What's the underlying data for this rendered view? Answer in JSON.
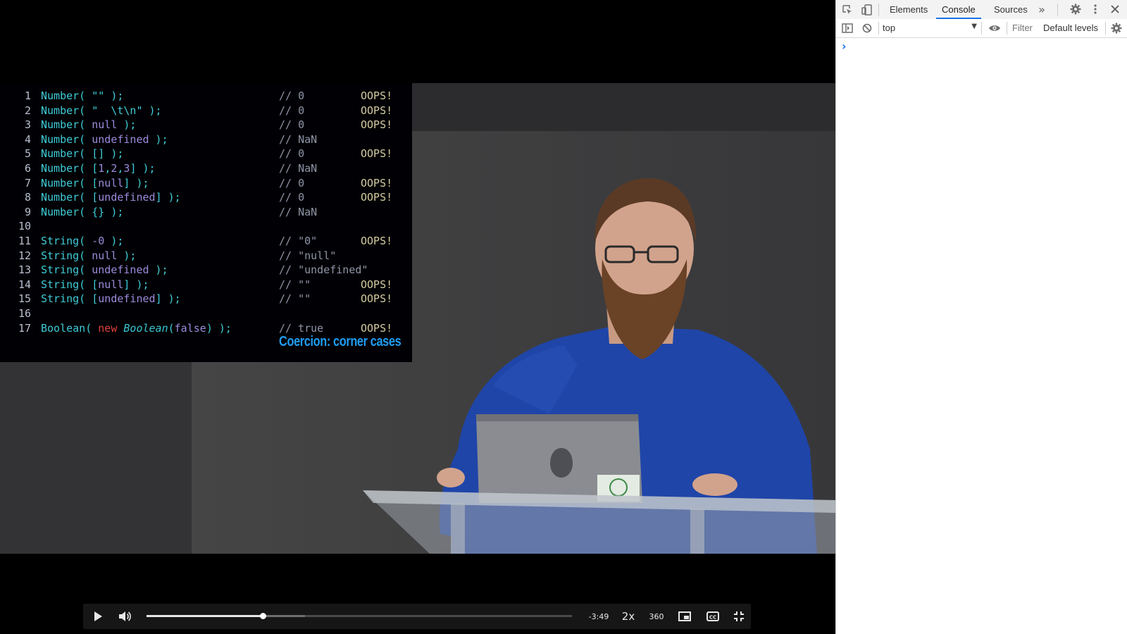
{
  "video": {
    "code_lines": [
      {
        "n": "1",
        "code": [
          {
            "t": "Number( \"\" );",
            "c": ""
          }
        ],
        "comment": "// 0",
        "oops": "OOPS!"
      },
      {
        "n": "2",
        "code": [
          {
            "t": "Number( \"  \\t\\n\" );",
            "c": ""
          }
        ],
        "comment": "// 0",
        "oops": "OOPS!"
      },
      {
        "n": "3",
        "code": [
          {
            "t": "Number( ",
            "c": ""
          },
          {
            "t": "null",
            "c": "kw-purple"
          },
          {
            "t": " );",
            "c": ""
          }
        ],
        "comment": "// 0",
        "oops": "OOPS!"
      },
      {
        "n": "4",
        "code": [
          {
            "t": "Number( ",
            "c": ""
          },
          {
            "t": "undefined",
            "c": "kw-purple"
          },
          {
            "t": " );",
            "c": ""
          }
        ],
        "comment": "// NaN",
        "oops": ""
      },
      {
        "n": "5",
        "code": [
          {
            "t": "Number( [] );",
            "c": ""
          }
        ],
        "comment": "// 0",
        "oops": "OOPS!"
      },
      {
        "n": "6",
        "code": [
          {
            "t": "Number( [",
            "c": ""
          },
          {
            "t": "1",
            "c": "kw-purple"
          },
          {
            "t": ",",
            "c": ""
          },
          {
            "t": "2",
            "c": "kw-purple"
          },
          {
            "t": ",",
            "c": ""
          },
          {
            "t": "3",
            "c": "kw-purple"
          },
          {
            "t": "] );",
            "c": ""
          }
        ],
        "comment": "// NaN",
        "oops": ""
      },
      {
        "n": "7",
        "code": [
          {
            "t": "Number( [",
            "c": ""
          },
          {
            "t": "null",
            "c": "kw-purple"
          },
          {
            "t": "] );",
            "c": ""
          }
        ],
        "comment": "// 0",
        "oops": "OOPS!"
      },
      {
        "n": "8",
        "code": [
          {
            "t": "Number( [",
            "c": ""
          },
          {
            "t": "undefined",
            "c": "kw-purple"
          },
          {
            "t": "] );",
            "c": ""
          }
        ],
        "comment": "// 0",
        "oops": "OOPS!"
      },
      {
        "n": "9",
        "code": [
          {
            "t": "Number( {} );",
            "c": ""
          }
        ],
        "comment": "// NaN",
        "oops": ""
      },
      {
        "n": "10",
        "code": [],
        "comment": "",
        "oops": ""
      },
      {
        "n": "11",
        "code": [
          {
            "t": "String( ",
            "c": ""
          },
          {
            "t": "-0",
            "c": "kw-purple"
          },
          {
            "t": " );",
            "c": ""
          }
        ],
        "comment": "// \"0\"",
        "oops": "OOPS!"
      },
      {
        "n": "12",
        "code": [
          {
            "t": "String( ",
            "c": ""
          },
          {
            "t": "null",
            "c": "kw-purple"
          },
          {
            "t": " );",
            "c": ""
          }
        ],
        "comment": "// \"null\"",
        "oops": ""
      },
      {
        "n": "13",
        "code": [
          {
            "t": "String( ",
            "c": ""
          },
          {
            "t": "undefined",
            "c": "kw-purple"
          },
          {
            "t": " );",
            "c": ""
          }
        ],
        "comment": "// \"undefined\"",
        "oops": ""
      },
      {
        "n": "14",
        "code": [
          {
            "t": "String( [",
            "c": ""
          },
          {
            "t": "null",
            "c": "kw-purple"
          },
          {
            "t": "] );",
            "c": ""
          }
        ],
        "comment": "// \"\"",
        "oops": "OOPS!"
      },
      {
        "n": "15",
        "code": [
          {
            "t": "String( [",
            "c": ""
          },
          {
            "t": "undefined",
            "c": "kw-purple"
          },
          {
            "t": "] );",
            "c": ""
          }
        ],
        "comment": "// \"\"",
        "oops": "OOPS!"
      },
      {
        "n": "16",
        "code": [],
        "comment": "",
        "oops": ""
      },
      {
        "n": "17",
        "code": [
          {
            "t": "Boolean( ",
            "c": ""
          },
          {
            "t": "new",
            "c": "kw-red"
          },
          {
            "t": " ",
            "c": ""
          },
          {
            "t": "Boolean",
            "c": "kw-ital"
          },
          {
            "t": "(",
            "c": ""
          },
          {
            "t": "false",
            "c": "kw-purple"
          },
          {
            "t": ") );",
            "c": ""
          }
        ],
        "comment": "// true",
        "oops": "OOPS!"
      }
    ],
    "caption": "Coercion: corner cases"
  },
  "player": {
    "time_remaining": "-3:49",
    "speed": "2x",
    "quality": "360",
    "progress_played": 0.273,
    "progress_buffered": 0.372,
    "icons": {
      "play": "play-icon",
      "volume": "volume-icon",
      "pip": "picture-in-picture-icon",
      "cc": "closed-captions-icon",
      "fullscreen": "exit-fullscreen-icon"
    }
  },
  "devtools": {
    "tabs": {
      "elements": "Elements",
      "console": "Console",
      "sources": "Sources"
    },
    "context": "top",
    "filter_placeholder": "Filter",
    "levels": "Default levels",
    "prompt": "›",
    "accent": "#1a73e8"
  }
}
